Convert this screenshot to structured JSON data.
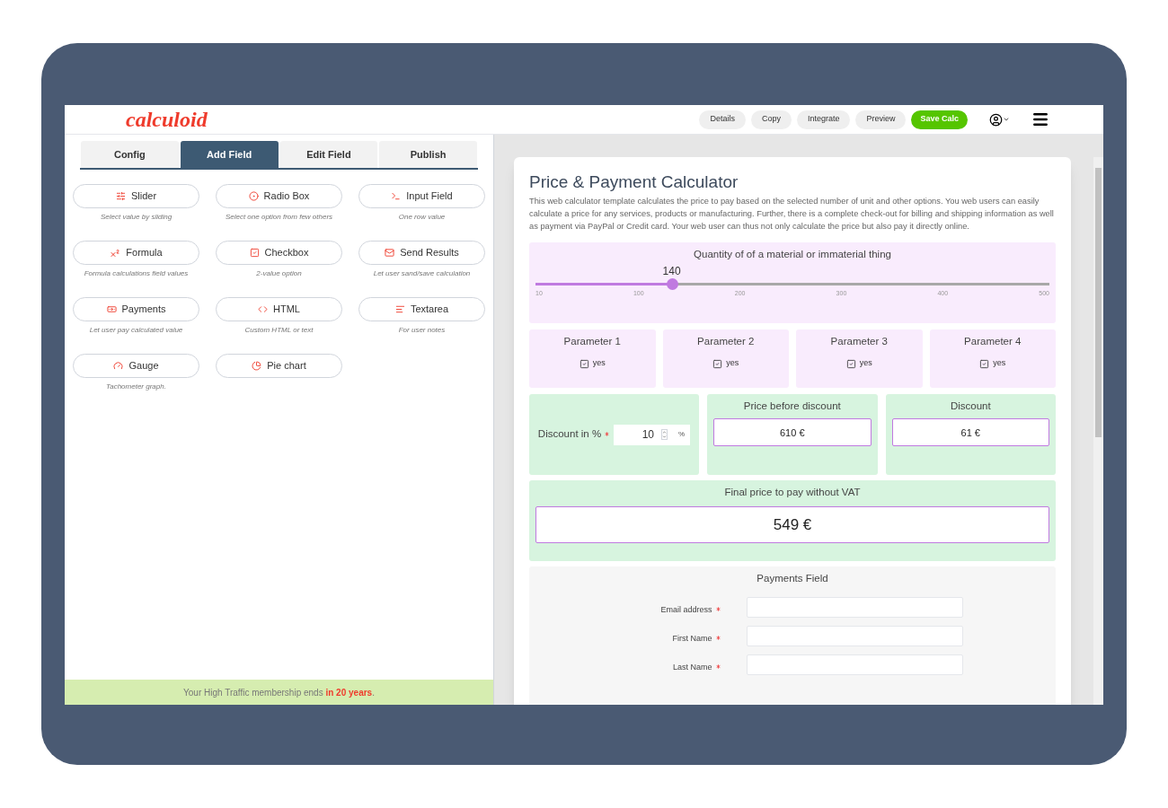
{
  "logo": "calculoid",
  "header_buttons": [
    {
      "label": "Details",
      "kind": "plain"
    },
    {
      "label": "Copy",
      "kind": "plain"
    },
    {
      "label": "Integrate",
      "kind": "plain"
    },
    {
      "label": "Preview",
      "kind": "plain"
    },
    {
      "label": "Save Calc",
      "kind": "primary"
    }
  ],
  "tabs": [
    {
      "label": "Config",
      "selected": false
    },
    {
      "label": "Add Field",
      "selected": true
    },
    {
      "label": "Edit Field",
      "selected": false
    },
    {
      "label": "Publish",
      "selected": false
    }
  ],
  "fields": [
    {
      "label": "Slider",
      "description": "Select value by sliding"
    },
    {
      "label": "Radio Box",
      "description": "Select one option from few others"
    },
    {
      "label": "Input Field",
      "description": "One row value"
    },
    {
      "label": "Formula",
      "description": "Formula calculations field values"
    },
    {
      "label": "Checkbox",
      "description": "2-value option"
    },
    {
      "label": "Send Results",
      "description": "Let user sand/save calculation"
    },
    {
      "label": "Payments",
      "description": "Let user pay calculated value"
    },
    {
      "label": "HTML",
      "description": "Custom HTML or text"
    },
    {
      "label": "Textarea",
      "description": "For user notes"
    },
    {
      "label": "Gauge",
      "description": "Tachometer graph."
    },
    {
      "label": "Pie chart"
    }
  ],
  "membership_notice": "Your High Traffic membership ends **in 20 years**.",
  "calculator": {
    "title": "Price & Payment Calculator",
    "description": "This web calculator template calculates the price to pay based on the selected number of unit and other options. You web users can easily calculate a price for any services, products or manufacturing. Further, there is a complete check-out for billing and shipping information as well as payment via PayPal or Credit card. Your web user can thus not only calculate the price but also pay it directly online.",
    "slider": {
      "label": "Quantity of of a material or immaterial thing",
      "value": "140",
      "level": 0.265,
      "ticks": [
        "10",
        "100",
        "200",
        "300",
        "400",
        "500"
      ]
    },
    "parameters": [
      {
        "label": "Parameter 1",
        "option": "yes",
        "checked": true
      },
      {
        "label": "Parameter 2",
        "option": "yes",
        "checked": true
      },
      {
        "label": "Parameter 3",
        "option": "yes",
        "checked": true
      },
      {
        "label": "Parameter 4",
        "option": "yes",
        "checked": true
      }
    ],
    "discount_input": {
      "label": "Discount in %",
      "required": true,
      "value": "10",
      "unit": "%"
    },
    "price_before_discount": {
      "label": "Price before discount",
      "value": "610 €"
    },
    "discount": {
      "label": "Discount",
      "value": "61 €"
    },
    "final_price": {
      "label": "Final price to pay without VAT",
      "value": "549 €"
    },
    "payments": {
      "title": "Payments Field",
      "fields": [
        {
          "label": "Email address",
          "required": true
        },
        {
          "label": "First Name",
          "required": true
        },
        {
          "label": "Last Name",
          "required": true
        }
      ]
    }
  }
}
